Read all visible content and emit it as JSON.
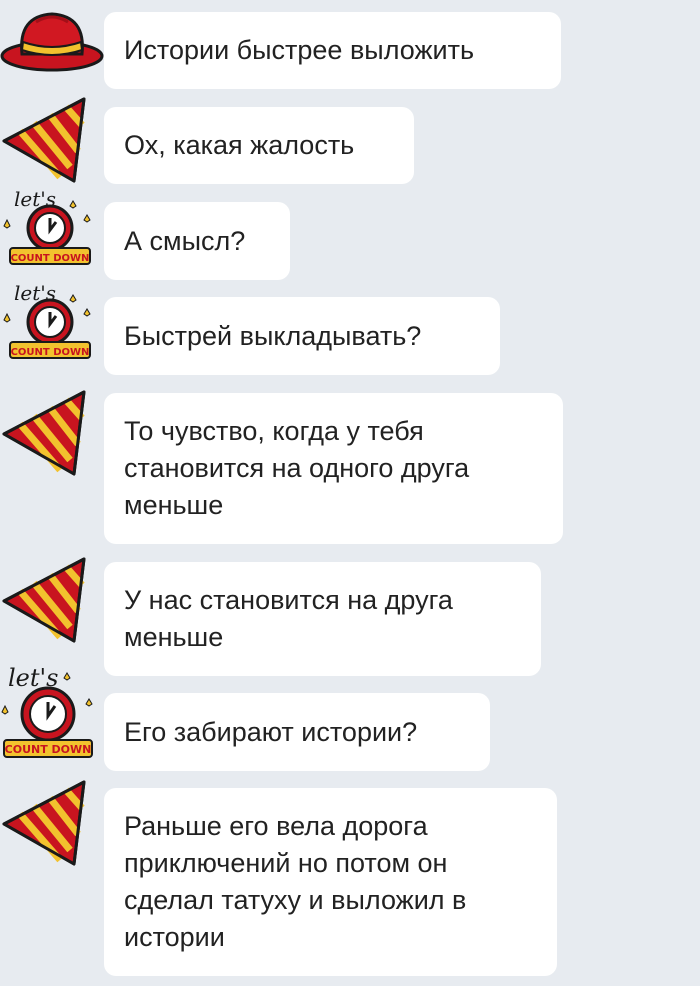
{
  "colors": {
    "background": "#e7ebf0",
    "bubble": "#ffffff",
    "text": "#222222",
    "red": "#c8141f",
    "gold": "#f2c22e",
    "dark": "#1a1a1a"
  },
  "messages": [
    {
      "avatar": "red-hat-icon",
      "text": "Истории быстрее выложить"
    },
    {
      "avatar": "party-streamer-icon",
      "text": "Ох, какая жалость"
    },
    {
      "avatar": "countdown-clock-icon",
      "text": "А смысл?"
    },
    {
      "avatar": "countdown-clock-icon",
      "text": "Быстрей выкладывать?"
    },
    {
      "avatar": "party-streamer-icon",
      "text": "То чувство, когда у тебя\nстановится на одного друга\nменьше"
    },
    {
      "avatar": "party-streamer-icon",
      "text": "У нас становится на друга\nменьше"
    },
    {
      "avatar": "countdown-clock-icon",
      "text": "Его забирают истории?"
    },
    {
      "avatar": "party-streamer-icon",
      "text": "Раньше его вела дорога\nприключений но потом он\nсделал татуху и выложил в\nистории"
    }
  ],
  "sticker_text": {
    "lets": "let's",
    "countdown": "COUNT DOWN"
  }
}
